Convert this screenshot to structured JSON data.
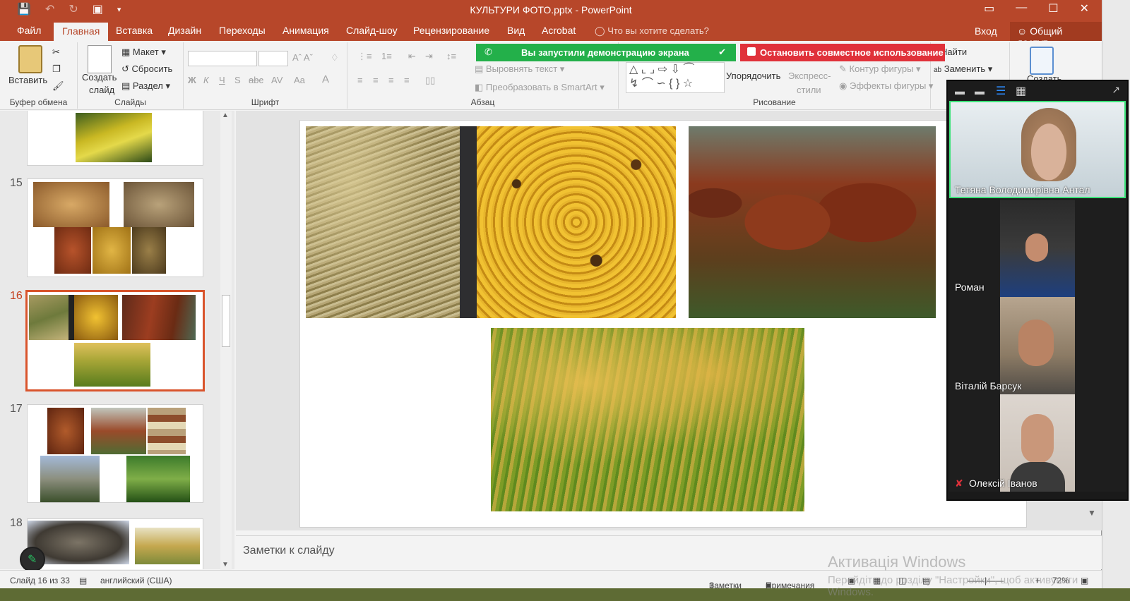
{
  "app": {
    "title": "КУЛЬТУРИ ФОТО.pptx - PowerPoint",
    "tabs": [
      "Файл",
      "Главная",
      "Вставка",
      "Дизайн",
      "Переходы",
      "Анимация",
      "Слайд-шоу",
      "Рецензирование",
      "Вид",
      "Acrobat"
    ],
    "active_tab": "Главная",
    "tell_me": "Что вы хотите сделать?",
    "login": "Вход",
    "share": "Общий доступ"
  },
  "ribbon": {
    "paste": "Вставить",
    "new_slide_1": "Создать",
    "new_slide_2": "слайд",
    "layout": "Макет",
    "reset": "Сбросить",
    "section": "Раздел",
    "align_text": "Выровнять текст",
    "smartart": "Преобразовать в SmartArt",
    "arrange": "Упорядочить",
    "express_1": "Экспресс-",
    "express_2": "стили",
    "shape_outline": "Контур фигуры",
    "shape_effects": "Эффекты фигуры",
    "find": "Найти",
    "replace": "Заменить",
    "create": "Создать",
    "groups": {
      "clipboard": "Буфер обмена",
      "slides": "Слайды",
      "font": "Шрифт",
      "paragraph": "Абзац",
      "drawing": "Рисование"
    }
  },
  "share_banner": {
    "green": "Вы запустили демонстрацию экрана",
    "red": "Остановить совместное использование"
  },
  "slides_panel": {
    "numbers": [
      "15",
      "16",
      "17",
      "18"
    ],
    "current": "16"
  },
  "notes_placeholder": "Заметки к слайду",
  "status": {
    "slide_info": "Слайд 16 из 33",
    "language": "английский (США)",
    "notes": "Заметки",
    "comments": "Примечания",
    "zoom": "72%"
  },
  "activation": {
    "line1": "Активація Windows",
    "line2": "Перейдіть до розділу \"Настройки\", щоб активувати",
    "line3": "Windows."
  },
  "participants": [
    {
      "name": "Тетяна Володимирівна Антал",
      "speaking": true
    },
    {
      "name": "Роман",
      "speaking": false
    },
    {
      "name": "Віталій Барсук",
      "speaking": false
    },
    {
      "name": "Олексій Іванов",
      "speaking": false,
      "muted": true
    }
  ],
  "colors": {
    "accent": "#b7472a",
    "share_green": "#23b04a",
    "share_red": "#e0313a"
  }
}
